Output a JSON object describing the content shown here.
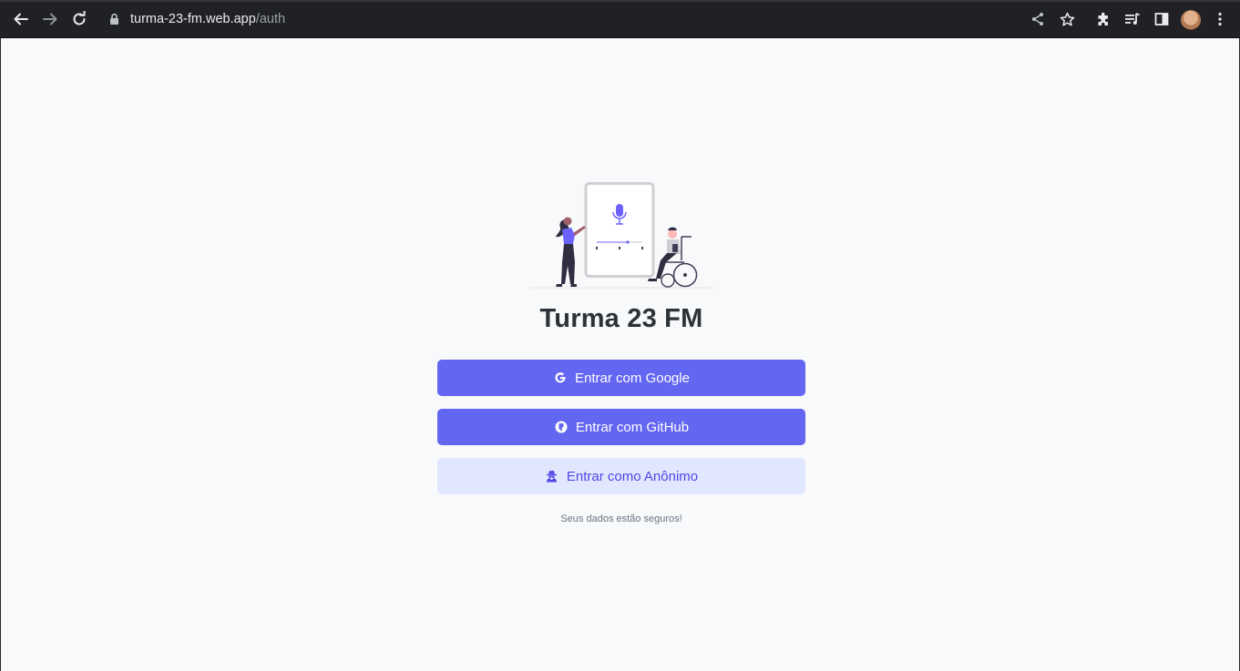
{
  "browser": {
    "url_host": "turma-23-fm.web.app",
    "url_path": "/auth"
  },
  "app": {
    "title": "Turma 23 FM",
    "buttons": {
      "google": "Entrar com Google",
      "github": "Entrar com GitHub",
      "anonymous": "Entrar como Anônimo"
    },
    "footnote": "Seus dados estão seguros!"
  },
  "colors": {
    "primary": "#6366f1",
    "secondary_bg": "#e0e7ff",
    "secondary_text": "#4f46e5",
    "title": "#2e3238"
  }
}
